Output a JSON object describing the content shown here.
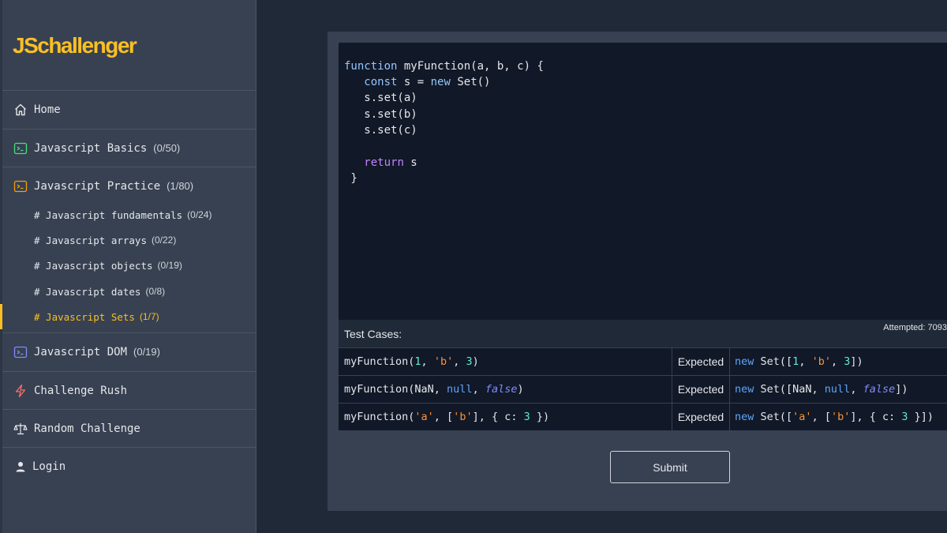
{
  "app": {
    "logo": "JSchallenger"
  },
  "sidebar": {
    "items": [
      {
        "label": "Home",
        "count": "",
        "icon": "home-icon"
      },
      {
        "label": "Javascript Basics",
        "count": "(0/50)",
        "icon": "terminal-icon"
      },
      {
        "label": "Javascript Practice",
        "count": "(1/80)",
        "icon": "terminal-icon"
      },
      {
        "label": "Javascript DOM",
        "count": "(0/19)",
        "icon": "terminal-icon"
      },
      {
        "label": "Challenge Rush",
        "count": "",
        "icon": "lightning-icon"
      },
      {
        "label": "Random Challenge",
        "count": "",
        "icon": "scale-icon"
      },
      {
        "label": "Login",
        "count": "",
        "icon": "user-icon"
      }
    ],
    "practice_subitems": [
      {
        "label": "# Javascript fundamentals",
        "count": "(0/24)"
      },
      {
        "label": "# Javascript arrays",
        "count": "(0/22)"
      },
      {
        "label": "# Javascript objects",
        "count": "(0/19)"
      },
      {
        "label": "# Javascript dates",
        "count": "(0/8)"
      },
      {
        "label": "# Javascript Sets",
        "count": "(1/7)"
      }
    ],
    "active_subitem": "# Javascript Sets",
    "colors": {
      "accent": "#fbbf24",
      "basics_icon": "#4ade80",
      "practice_icon": "#f59e0b",
      "dom_icon": "#818cf8",
      "rush_icon": "#f87171"
    }
  },
  "editor": {
    "lines": [
      "function myFunction(a, b, c) {",
      "   const s = new Set()",
      "   s.set(a)",
      "   s.set(b)",
      "   s.set(c)",
      "",
      "   return s",
      " }"
    ]
  },
  "tests": {
    "title": "Test Cases:",
    "attempted": "Attempted: 7093",
    "expected_label": "Expected",
    "rows": [
      {
        "input": "myFunction(1, 'b', 3)",
        "expected": "new Set([1, 'b', 3])"
      },
      {
        "input": "myFunction(NaN, null, false)",
        "expected": "new Set([NaN, null, false])"
      },
      {
        "input": "myFunction('a', ['b'], { c: 3 })",
        "expected": "new Set(['a', ['b'], { c: 3 }])"
      }
    ]
  },
  "actions": {
    "submit_label": "Submit"
  }
}
